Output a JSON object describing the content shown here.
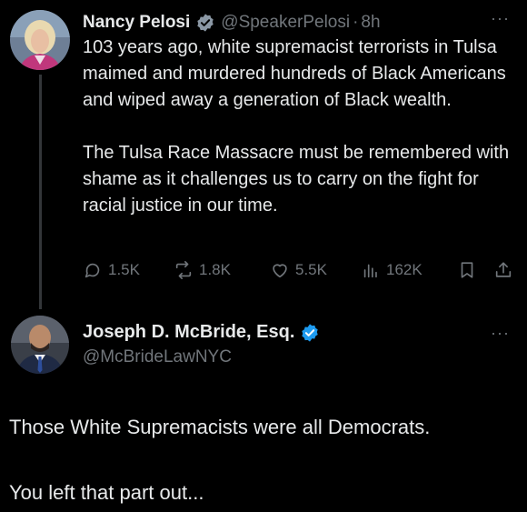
{
  "post1": {
    "author_name": "Nancy Pelosi",
    "handle": "@SpeakerPelosi",
    "separator": "·",
    "time": "8h",
    "more_label": "···",
    "paragraph1": "103 years ago, white supremacist terrorists in Tulsa maimed and murdered hundreds of Black Americans and wiped away a generation of Black wealth.",
    "paragraph2": "The Tulsa Race Massacre must be remembered with shame as it challenges us to carry on the fight for racial justice in our time.",
    "replies": "1.5K",
    "reposts": "1.8K",
    "likes": "5.5K",
    "views": "162K"
  },
  "post2": {
    "author_name": "Joseph D. McBride, Esq.",
    "handle": "@McBrideLawNYC",
    "more_label": "···",
    "paragraph1": "Those White Supremacists were all Democrats.",
    "paragraph2": "You left that part out..."
  },
  "colors": {
    "background": "#000000",
    "text": "#e7e9ea",
    "muted": "#71767b",
    "verified_badge_post1": "#8b98a5",
    "verified_badge_post2": "#1d9bf0"
  },
  "icons": [
    "reply-icon",
    "repost-icon",
    "like-icon",
    "views-icon",
    "bookmark-icon",
    "share-icon",
    "verified-icon"
  ]
}
